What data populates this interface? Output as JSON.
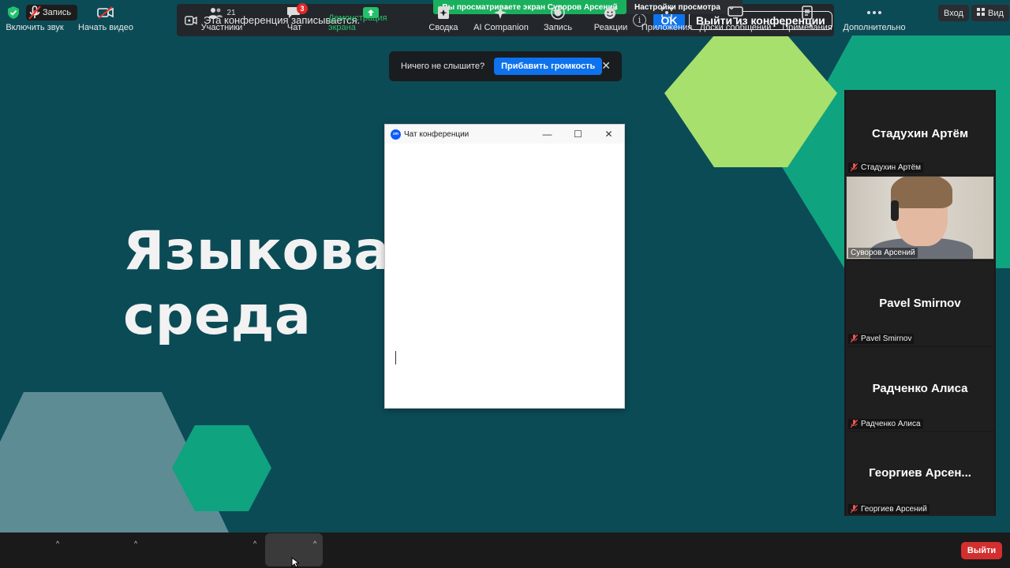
{
  "indicators": {
    "recording_label": "Запись"
  },
  "banner": {
    "recording_text": "Эта конференция записывается.",
    "info": "i",
    "ok": "OK",
    "leave_conference": "Выйти из конференции",
    "viewing": "Вы просматриваете экран Суворов Арсений",
    "view_settings": "Настройки просмотра",
    "view_settings_caret": "⌄"
  },
  "top_right": {
    "login": "Вход",
    "view": "Вид"
  },
  "audio_prompt": {
    "question": "Ничего не слышите?",
    "boost": "Прибавить громкость",
    "close": "✕"
  },
  "slide": {
    "line1": "Языковая",
    "line2": "среда"
  },
  "chat": {
    "logo": "zm",
    "title": "Чат конференции",
    "minimize": "—",
    "maximize": "☐",
    "close": "✕"
  },
  "gallery": {
    "tiles": [
      {
        "name": "Стадухин Артём",
        "label": "Стадухин Артём"
      },
      {
        "label": "Суворов Арсений"
      },
      {
        "name": "Pavel Smirnov",
        "label": "Pavel Smirnov"
      },
      {
        "name": "Радченко Алиса",
        "label": "Радченко Алиса"
      },
      {
        "name": "Георгиев  Арсен...",
        "label": "Георгиев Арсений"
      }
    ]
  },
  "toolbar": {
    "audio": "Включить звук",
    "video": "Начать видео",
    "participants": "Участники",
    "participants_count": "21",
    "chat": "Чат",
    "chat_badge": "3",
    "share": "Демонстрация экрана",
    "summary": "Сводка",
    "ai": "AI Companion",
    "record": "Запись",
    "reactions": "Реакции",
    "apps": "Приложения",
    "whiteboards": "Доски сообщений",
    "notes": "Примечания",
    "more": "Дополнительно",
    "leave": "Выйти",
    "caret": "^"
  },
  "colors": {
    "accent": "#0e72ed",
    "share_green": "#1aaf5d",
    "leave_red": "#d32f2f",
    "slide_bg": "#0b4b56",
    "hex_light": "#a8e06e",
    "hex_teal": "#0fa37f",
    "hex_grey": "#5d8c95"
  }
}
